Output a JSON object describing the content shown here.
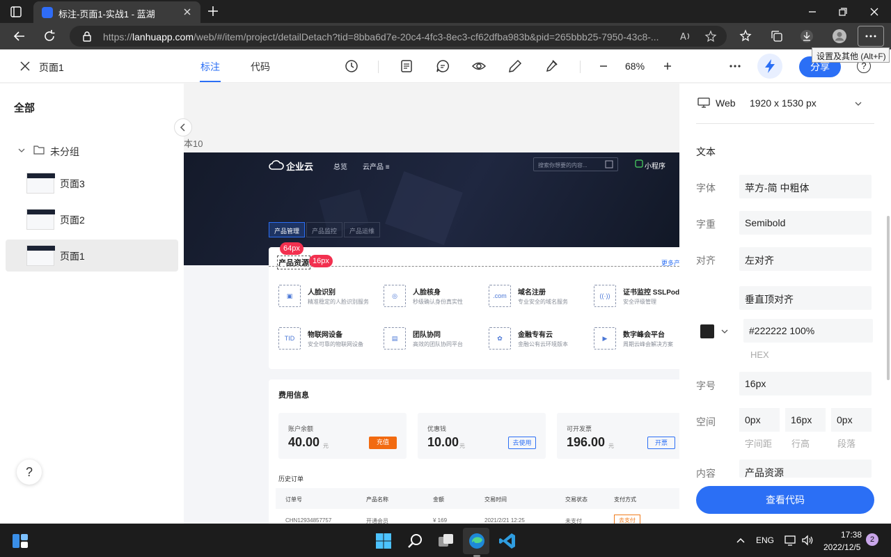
{
  "browser": {
    "tab_title": "标注-页面1-实战1 - 蓝湖",
    "url_prefix": "https://",
    "url_host": "lanhuapp.com",
    "url_rest": "/web/#/item/project/detailDetach?tid=8bba6d7e-20c4-4fc3-8ec3-cf62dfba983b&pid=265bbb25-7950-43c8-...",
    "tooltip": "设置及其他 (Alt+F)"
  },
  "header": {
    "page_name": "页面1",
    "tabs": [
      "标注",
      "代码"
    ],
    "zoom": "68%",
    "share_label": "分享",
    "help": "?"
  },
  "sidebar": {
    "all_label": "全部",
    "group_label": "未分组",
    "pages": [
      "页面3",
      "页面2",
      "页面1"
    ],
    "help": "?"
  },
  "canvas": {
    "artboard_label": "本10",
    "site": {
      "logo": "企业云",
      "nav": [
        "总览",
        "云产品 ≡"
      ],
      "search_placeholder": "搜索你想要的内容...",
      "mini_program": "小程序",
      "product_tabs": [
        "产品管理",
        "产品监控",
        "产品运维"
      ],
      "product_title": "产品资源",
      "more": "更多产",
      "products": [
        {
          "name": "人脸识别",
          "desc": "精准稳定的人脸识别服务"
        },
        {
          "name": "人脸核身",
          "desc": "秒级确认身份真实性"
        },
        {
          "name": "域名注册",
          "desc": "专业安全的域名服务"
        },
        {
          "name": "证书监控 SSLPod",
          "desc": "安全评级管理"
        },
        {
          "name": "物联网设备",
          "desc": "安全可靠的物联网设备"
        },
        {
          "name": "团队协同",
          "desc": "高效的团队协同平台"
        },
        {
          "name": "金融专有云",
          "desc": "金融公有云环境版本"
        },
        {
          "name": "数字峰会平台",
          "desc": "周期云峰会解决方案"
        }
      ],
      "fee_title": "费用信息",
      "fees": [
        {
          "label": "账户余额",
          "value": "40.00",
          "unit": "元",
          "button": "充值"
        },
        {
          "label": "优惠钱",
          "value": "10.00",
          "unit": "元",
          "button": "去使用"
        },
        {
          "label": "可开发票",
          "value": "196.00",
          "unit": "元",
          "button": "开票"
        }
      ],
      "history_title": "历史订单",
      "table_headers": [
        "订单号",
        "产品名称",
        "金额",
        "交易时间",
        "交易状态",
        "支付方式"
      ],
      "row": [
        "CHN12934857757",
        "开通会员",
        "¥ 169",
        "2021/2/21 12:25",
        "未支付",
        "去支付"
      ]
    },
    "badges": [
      "64px",
      "16px"
    ]
  },
  "panel": {
    "device": "Web",
    "size": "1920 x 1530 px",
    "section": "文本",
    "props": [
      {
        "label": "字体",
        "value": "苹方-简 中粗体"
      },
      {
        "label": "字重",
        "value": "Semibold"
      },
      {
        "label": "对齐",
        "value": "左对齐"
      },
      {
        "label": "",
        "value": "垂直顶对齐"
      }
    ],
    "color_value": "#222222   100%",
    "color_caption": "HEX",
    "size_label": "字号",
    "size_value": "16px",
    "space_label": "空间",
    "spacing": [
      {
        "value": "0px",
        "caption": "字间距"
      },
      {
        "value": "16px",
        "caption": "行高"
      },
      {
        "value": "0px",
        "caption": "段落"
      }
    ],
    "content_label": "内容",
    "content_value": "产品资源",
    "view_code": "查看代码"
  },
  "taskbar": {
    "lang": "ENG",
    "time": "17:38",
    "date": "2022/12/5",
    "notifications": "2"
  }
}
